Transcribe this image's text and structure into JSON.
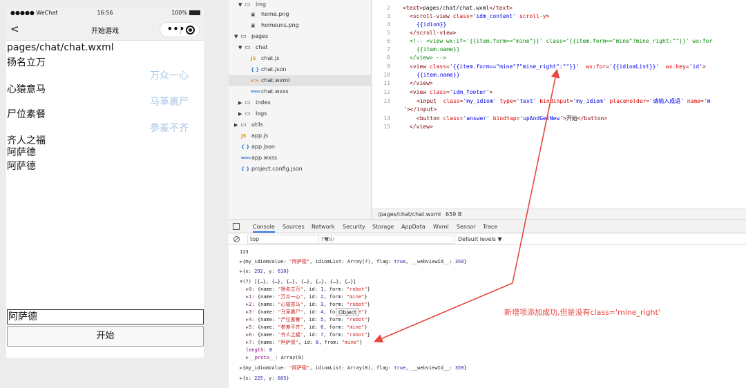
{
  "phone": {
    "status": {
      "signal": "●●●●● WeChat",
      "time": "16:56",
      "battery": "100%"
    },
    "nav": {
      "back": "<",
      "title": "开始游戏"
    },
    "content": {
      "path_text": "pages/chat/chat.wxml",
      "items": [
        {
          "text": "扬名立万",
          "side": "robot"
        },
        {
          "text": "万众一心",
          "side": "mine"
        },
        {
          "text": "心猿意马",
          "side": "robot"
        },
        {
          "text": "马革裹尸",
          "side": "mine"
        },
        {
          "text": "尸位素餐",
          "side": "robot"
        },
        {
          "text": "参差不齐",
          "side": "mine"
        },
        {
          "text": "齐人之福",
          "side": "robot"
        },
        {
          "text": "阿萨德",
          "side": "mine"
        },
        {
          "text": "阿萨德",
          "side": "mine"
        }
      ]
    },
    "input_value": "阿萨德",
    "button_label": "开始"
  },
  "file_tree": [
    {
      "name": "img",
      "type": "folder",
      "open": true,
      "depth": 1
    },
    {
      "name": "home.png",
      "type": "img",
      "depth": 2
    },
    {
      "name": "homeuns.png",
      "type": "img",
      "depth": 2
    },
    {
      "name": "pages",
      "type": "folder",
      "open": true,
      "depth": 0
    },
    {
      "name": "chat",
      "type": "folder",
      "open": true,
      "depth": 1
    },
    {
      "name": "chat.js",
      "type": "js",
      "depth": 2
    },
    {
      "name": "chat.json",
      "type": "json",
      "depth": 2
    },
    {
      "name": "chat.wxml",
      "type": "wxml",
      "depth": 2,
      "selected": true
    },
    {
      "name": "chat.wxss",
      "type": "wxss",
      "depth": 2
    },
    {
      "name": "index",
      "type": "folder",
      "open": false,
      "depth": 1
    },
    {
      "name": "logs",
      "type": "folder",
      "open": false,
      "depth": 1
    },
    {
      "name": "utils",
      "type": "folder",
      "open": false,
      "depth": 0
    },
    {
      "name": "app.js",
      "type": "js",
      "depth": 0
    },
    {
      "name": "app.json",
      "type": "json",
      "depth": 0
    },
    {
      "name": "app.wxss",
      "type": "wxss",
      "depth": 0
    },
    {
      "name": "project.config.json",
      "type": "json",
      "depth": 0
    }
  ],
  "editor": {
    "lines": [
      {
        "n": "2",
        "parts": [
          [
            "tag",
            "<text>"
          ],
          [
            "txt",
            "pages/chat/chat.wxml"
          ],
          [
            "tag",
            "</text>"
          ]
        ],
        "indent": 0
      },
      {
        "n": "3",
        "parts": [
          [
            "tag",
            "<scroll-view "
          ],
          [
            "attr",
            "class"
          ],
          [
            "tag",
            "="
          ],
          [
            "str",
            "'idm_content'"
          ],
          [
            "attr",
            " scroll-y"
          ],
          [
            "tag",
            ">"
          ]
        ],
        "indent": 1
      },
      {
        "n": "4",
        "parts": [
          [
            "str",
            "{{idiom}}"
          ]
        ],
        "indent": 2
      },
      {
        "n": "5",
        "parts": [
          [
            "tag",
            "</scroll-view>"
          ]
        ],
        "indent": 1
      },
      {
        "n": "6",
        "parts": [
          [
            "cmt",
            "<!-- <view wx:if='{{item.form==\"mine\"}}' class='{{item.form==\"mine\"?mine_right:\"\"}}' wx:for"
          ]
        ],
        "indent": 1
      },
      {
        "n": "7",
        "parts": [
          [
            "cmt",
            "{{item.name}}"
          ]
        ],
        "indent": 2
      },
      {
        "n": "8",
        "parts": [
          [
            "cmt",
            "</view> -->"
          ]
        ],
        "indent": 1
      },
      {
        "n": "9",
        "parts": [
          [
            "tag",
            "<view "
          ],
          [
            "attr",
            "class"
          ],
          [
            "tag",
            "="
          ],
          [
            "str",
            "'{{item.form==\"mine\"?\"mine_right\":\"\"}}'"
          ],
          [
            "attr",
            "  wx:for"
          ],
          [
            "tag",
            "="
          ],
          [
            "str",
            "'{{idiomList}}'"
          ],
          [
            "attr",
            "  wx:key"
          ],
          [
            "tag",
            "="
          ],
          [
            "str",
            "'id'"
          ],
          [
            "tag",
            ">"
          ]
        ],
        "indent": 1
      },
      {
        "n": "10",
        "parts": [
          [
            "str",
            "{{item.name}}"
          ]
        ],
        "indent": 2
      },
      {
        "n": "11",
        "parts": [
          [
            "tag",
            "</view>"
          ]
        ],
        "indent": 1
      },
      {
        "n": "12",
        "parts": [
          [
            "tag",
            "<view "
          ],
          [
            "attr",
            "class"
          ],
          [
            "tag",
            "="
          ],
          [
            "str",
            "'idm_footer'"
          ],
          [
            "tag",
            ">"
          ]
        ],
        "indent": 1
      },
      {
        "n": "13",
        "parts": [
          [
            "tag",
            "<input "
          ],
          [
            "attr",
            " class"
          ],
          [
            "tag",
            "="
          ],
          [
            "str",
            "'my_idiom'"
          ],
          [
            "attr",
            " type"
          ],
          [
            "tag",
            "="
          ],
          [
            "str",
            "'text'"
          ],
          [
            "attr",
            " bindinput"
          ],
          [
            "tag",
            "="
          ],
          [
            "str",
            "'my_idiom'"
          ],
          [
            "attr",
            " placeholder"
          ],
          [
            "tag",
            "="
          ],
          [
            "str",
            "'请输入成语'"
          ],
          [
            "attr",
            " name"
          ],
          [
            "tag",
            "="
          ],
          [
            "str",
            "'m"
          ]
        ],
        "indent": 2
      },
      {
        "n": "",
        "parts": [
          [
            "str",
            "'"
          ],
          [
            "tag",
            "></input>"
          ]
        ],
        "indent": -1
      },
      {
        "n": "14",
        "parts": [
          [
            "tag",
            "<button "
          ],
          [
            "attr",
            "class"
          ],
          [
            "tag",
            "="
          ],
          [
            "str",
            "'answer'"
          ],
          [
            "attr",
            " bindtap"
          ],
          [
            "tag",
            "="
          ],
          [
            "str",
            "'upAndGetNew'"
          ],
          [
            "tag",
            ">"
          ],
          [
            "txt",
            "开始"
          ],
          [
            "tag",
            "</button>"
          ]
        ],
        "indent": 2
      },
      {
        "n": "15",
        "parts": [
          [
            "tag",
            "</view>"
          ]
        ],
        "indent": 1
      }
    ],
    "status_path": "/pages/chat/chat.wxml",
    "status_size": "659 B"
  },
  "devtools": {
    "tabs": [
      "Console",
      "Sources",
      "Network",
      "Security",
      "Storage",
      "AppData",
      "Wxml",
      "Sensor",
      "Trace"
    ],
    "active_tab": "Console",
    "context": "top",
    "filter_placeholder": "Filter",
    "levels": "Default levels ▼",
    "console": [
      {
        "indent": 0,
        "parts": [
          [
            "k",
            "123"
          ]
        ]
      },
      {
        "indent": 0,
        "parts": [
          [
            "g",
            "▶"
          ],
          [
            "k",
            "{my_idiomValue: "
          ],
          [
            "s",
            "\"阿萨德\""
          ],
          [
            "k",
            ", idiomList: Array(7), flag: "
          ],
          [
            "b",
            "true"
          ],
          [
            "k",
            ", __webviewId__: "
          ],
          [
            "b",
            "359"
          ],
          [
            "k",
            "}"
          ]
        ]
      },
      {
        "indent": 0,
        "parts": [
          [
            "g",
            "▶"
          ],
          [
            "k",
            "{x: "
          ],
          [
            "b",
            "292"
          ],
          [
            "k",
            ", y: "
          ],
          [
            "b",
            "610"
          ],
          [
            "k",
            "}"
          ]
        ]
      },
      {
        "indent": 0,
        "parts": [
          [
            "g",
            "▼"
          ],
          [
            "k",
            "(7) [{…}, {…}, {…}, {…}, {…}, {…}, {…}]"
          ]
        ]
      },
      {
        "indent": 1,
        "parts": [
          [
            "g",
            "▶"
          ],
          [
            "p",
            "0"
          ],
          [
            "k",
            ": {name: "
          ],
          [
            "s",
            "\"扬名立万\""
          ],
          [
            "k",
            ", id: "
          ],
          [
            "b",
            "1"
          ],
          [
            "k",
            ", form: "
          ],
          [
            "s",
            "\"robot\""
          ],
          [
            "k",
            "}"
          ]
        ]
      },
      {
        "indent": 1,
        "parts": [
          [
            "g",
            "▶"
          ],
          [
            "p",
            "1"
          ],
          [
            "k",
            ": {name: "
          ],
          [
            "s",
            "\"万众一心\""
          ],
          [
            "k",
            ", id: "
          ],
          [
            "b",
            "2"
          ],
          [
            "k",
            ", form: "
          ],
          [
            "s",
            "\"mine\""
          ],
          [
            "k",
            "}"
          ]
        ]
      },
      {
        "indent": 1,
        "parts": [
          [
            "g",
            "▶"
          ],
          [
            "p",
            "2"
          ],
          [
            "k",
            ": {name: "
          ],
          [
            "s",
            "\"心猿意马\""
          ],
          [
            "k",
            ", id: "
          ],
          [
            "b",
            "3"
          ],
          [
            "k",
            ", form: "
          ],
          [
            "s",
            "\"robot\""
          ],
          [
            "k",
            "}"
          ]
        ]
      },
      {
        "indent": 1,
        "parts": [
          [
            "g",
            "▶"
          ],
          [
            "p",
            "3"
          ],
          [
            "k",
            ": {name: "
          ],
          [
            "s",
            "\"马革裹尸\""
          ],
          [
            "k",
            ", id: "
          ],
          [
            "b",
            "4"
          ],
          [
            "k",
            ", form: "
          ],
          [
            "s",
            "\"mine\""
          ],
          [
            "k",
            "}"
          ]
        ]
      },
      {
        "indent": 1,
        "parts": [
          [
            "g",
            "▶"
          ],
          [
            "p",
            "4"
          ],
          [
            "k",
            ": {name: "
          ],
          [
            "s",
            "\"尸位素餐\""
          ],
          [
            "k",
            ", id: "
          ],
          [
            "b",
            "5"
          ],
          [
            "k",
            ", form: "
          ],
          [
            "s",
            "\"robot\""
          ],
          [
            "k",
            "}"
          ]
        ]
      },
      {
        "indent": 1,
        "parts": [
          [
            "g",
            "▶"
          ],
          [
            "p",
            "5"
          ],
          [
            "k",
            ": {name: "
          ],
          [
            "s",
            "\"参差不齐\""
          ],
          [
            "k",
            ", id: "
          ],
          [
            "b",
            "6"
          ],
          [
            "k",
            ", form: "
          ],
          [
            "s",
            "\"mine\""
          ],
          [
            "k",
            "}"
          ]
        ]
      },
      {
        "indent": 1,
        "parts": [
          [
            "g",
            "▶"
          ],
          [
            "p",
            "6"
          ],
          [
            "k",
            ": {name: "
          ],
          [
            "s",
            "\"齐人之福\""
          ],
          [
            "k",
            ", id: "
          ],
          [
            "b",
            "7"
          ],
          [
            "k",
            ", form: "
          ],
          [
            "s",
            "\"robot\""
          ],
          [
            "k",
            "}"
          ]
        ]
      },
      {
        "indent": 1,
        "parts": [
          [
            "g",
            "▶"
          ],
          [
            "p",
            "7"
          ],
          [
            "k",
            ": {name: "
          ],
          [
            "s",
            "\"阿萨德\""
          ],
          [
            "k",
            ", id: "
          ],
          [
            "b",
            "8"
          ],
          [
            "k",
            ", from: "
          ],
          [
            "s",
            "\"mine\""
          ],
          [
            "k",
            "}"
          ]
        ]
      },
      {
        "indent": 1,
        "parts": [
          [
            "p",
            "length"
          ],
          [
            "k",
            ": "
          ],
          [
            "b",
            "8"
          ]
        ]
      },
      {
        "indent": 1,
        "parts": [
          [
            "g",
            "▶"
          ],
          [
            "p",
            "__proto__"
          ],
          [
            "k",
            ": Array(0)"
          ]
        ]
      },
      {
        "indent": 0,
        "parts": [
          [
            "g",
            "▶"
          ],
          [
            "k",
            "{my_idiomValue: "
          ],
          [
            "s",
            "\"阿萨德\""
          ],
          [
            "k",
            ", idiomList: Array(8), flag: "
          ],
          [
            "b",
            "true"
          ],
          [
            "k",
            ", __webviewId__: "
          ],
          [
            "b",
            "359"
          ],
          [
            "k",
            "}"
          ]
        ]
      },
      {
        "indent": 0,
        "parts": [
          [
            "g",
            "▶"
          ],
          [
            "k",
            "{x: "
          ],
          [
            "b",
            "225"
          ],
          [
            "k",
            ", y: "
          ],
          [
            "b",
            "605"
          ],
          [
            "k",
            "}"
          ]
        ]
      }
    ],
    "tooltip": "Object"
  },
  "annotation": {
    "text": "新增项添加成功,但是没有class='mine_right'",
    "color": "#e7453d"
  }
}
